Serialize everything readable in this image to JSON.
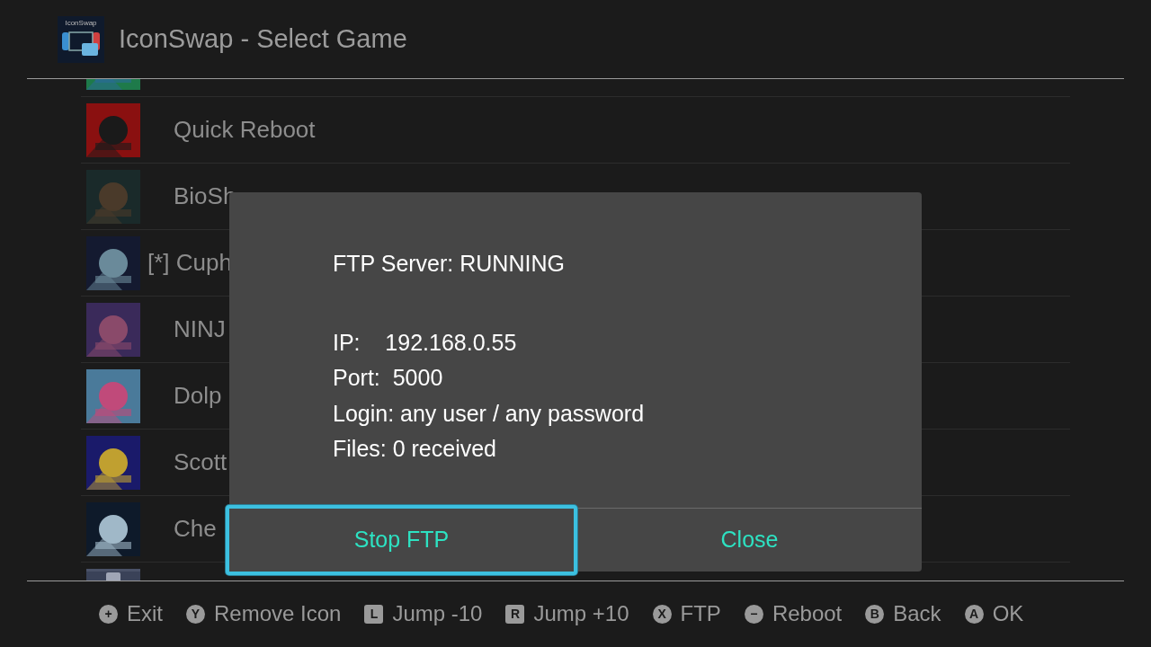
{
  "header": {
    "logo_text": "IconSwap",
    "title": "IconSwap - Select Game"
  },
  "games": [
    {
      "kind": "cut-top"
    },
    {
      "title": "Quick Reboot"
    },
    {
      "title": "BioSh"
    },
    {
      "title": "[*] Cuph"
    },
    {
      "title": "NINJ"
    },
    {
      "title": "Dolp"
    },
    {
      "title": "Scott"
    },
    {
      "title": "Che"
    },
    {
      "kind": "cut-bottom"
    }
  ],
  "dialog": {
    "status": "FTP Server: RUNNING",
    "lines": [
      "IP:    192.168.0.55",
      "Port:  5000",
      "Login: any user / any password",
      "Files: 0 received"
    ],
    "buttons": [
      {
        "label": "Stop FTP",
        "selected": true
      },
      {
        "label": "Close",
        "selected": false
      }
    ]
  },
  "footer": [
    {
      "glyph": "+",
      "label": "Exit",
      "kind": "circle"
    },
    {
      "glyph": "Y",
      "label": "Remove Icon",
      "kind": "circle"
    },
    {
      "glyph": "L",
      "label": "Jump -10",
      "kind": "square"
    },
    {
      "glyph": "R",
      "label": "Jump +10",
      "kind": "square"
    },
    {
      "glyph": "X",
      "label": "FTP",
      "kind": "circle"
    },
    {
      "glyph": "−",
      "label": "Reboot",
      "kind": "circle"
    },
    {
      "glyph": "B",
      "label": "Back",
      "kind": "circle"
    },
    {
      "glyph": "A",
      "label": "OK",
      "kind": "circle"
    }
  ]
}
